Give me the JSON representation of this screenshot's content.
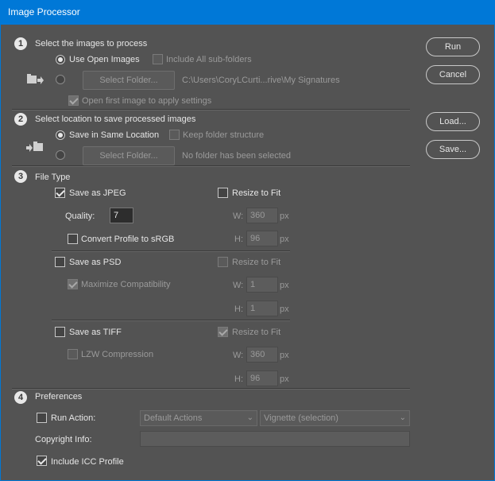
{
  "window": {
    "title": "Image Processor"
  },
  "section1": {
    "number": "1",
    "title": "Select the images to process",
    "use_open_images": "Use Open Images",
    "include_subfolders": "Include All sub-folders",
    "select_folder_btn": "Select Folder...",
    "source_path": "C:\\Users\\CoryLCurti...rive\\My Signatures",
    "open_first_image": "Open first image to apply settings"
  },
  "section2": {
    "number": "2",
    "title": "Select location to save processed images",
    "save_same_location": "Save in Same Location",
    "keep_folder_structure": "Keep folder structure",
    "select_folder_btn": "Select Folder...",
    "dest_status": "No folder has been selected"
  },
  "section3": {
    "number": "3",
    "title": "File Type",
    "jpeg": {
      "save_as": "Save as JPEG",
      "resize": "Resize to Fit",
      "quality_label": "Quality:",
      "quality_value": "7",
      "convert_profile": "Convert Profile to sRGB",
      "w_label": "W:",
      "w_value": "360",
      "w_unit": "px",
      "h_label": "H:",
      "h_value": "96",
      "h_unit": "px"
    },
    "psd": {
      "save_as": "Save as PSD",
      "resize": "Resize to Fit",
      "maximize": "Maximize Compatibility",
      "w_label": "W:",
      "w_value": "1",
      "w_unit": "px",
      "h_label": "H:",
      "h_value": "1",
      "h_unit": "px"
    },
    "tiff": {
      "save_as": "Save as TIFF",
      "resize": "Resize to Fit",
      "lzw": "LZW Compression",
      "w_label": "W:",
      "w_value": "360",
      "w_unit": "px",
      "h_label": "H:",
      "h_value": "96",
      "h_unit": "px"
    }
  },
  "section4": {
    "number": "4",
    "title": "Preferences",
    "run_action": "Run Action:",
    "action_set": "Default Actions",
    "action": "Vignette (selection)",
    "copyright_label": "Copyright Info:",
    "copyright_value": "",
    "include_icc": "Include ICC Profile"
  },
  "buttons": {
    "run": "Run",
    "cancel": "Cancel",
    "load": "Load...",
    "save": "Save..."
  },
  "colors": {
    "titlebar": "#0078d7",
    "background": "#535353"
  }
}
